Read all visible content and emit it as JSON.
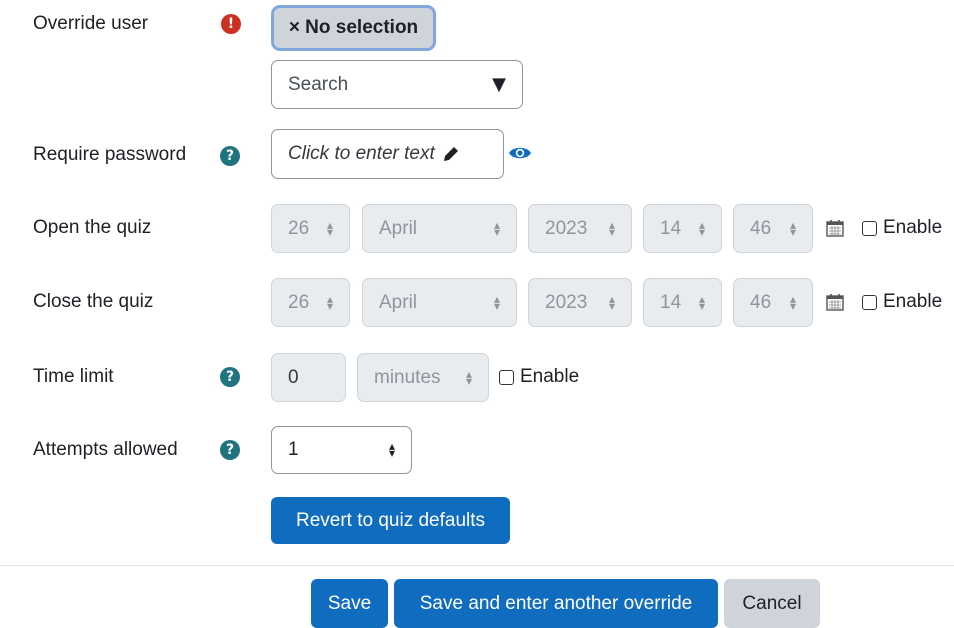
{
  "override_user": {
    "label": "Override user",
    "selection_chip": "× No selection",
    "search_placeholder": "Search",
    "dropdown_arrow": "▼"
  },
  "require_password": {
    "label": "Require password",
    "placeholder": "Click to enter text",
    "edit_icon": "pencil-icon",
    "reveal_icon": "eye-icon"
  },
  "open_quiz": {
    "label": "Open the quiz",
    "day": "26",
    "month": "April",
    "year": "2023",
    "hour": "14",
    "minute": "46",
    "enable_label": "Enable"
  },
  "close_quiz": {
    "label": "Close the quiz",
    "day": "26",
    "month": "April",
    "year": "2023",
    "hour": "14",
    "minute": "46",
    "enable_label": "Enable"
  },
  "time_limit": {
    "label": "Time limit",
    "value": "0",
    "unit": "minutes",
    "enable_label": "Enable"
  },
  "attempts": {
    "label": "Attempts allowed",
    "value": "1"
  },
  "buttons": {
    "revert": "Revert to quiz defaults",
    "save": "Save",
    "save_another": "Save and enter another override",
    "cancel": "Cancel"
  },
  "icons": {
    "required": "!",
    "help": "?",
    "calendar": "📅"
  },
  "colors": {
    "primary": "#0f6cbf",
    "required": "#ca3120",
    "help": "#1f7480",
    "chip_bg": "#ced4da"
  }
}
